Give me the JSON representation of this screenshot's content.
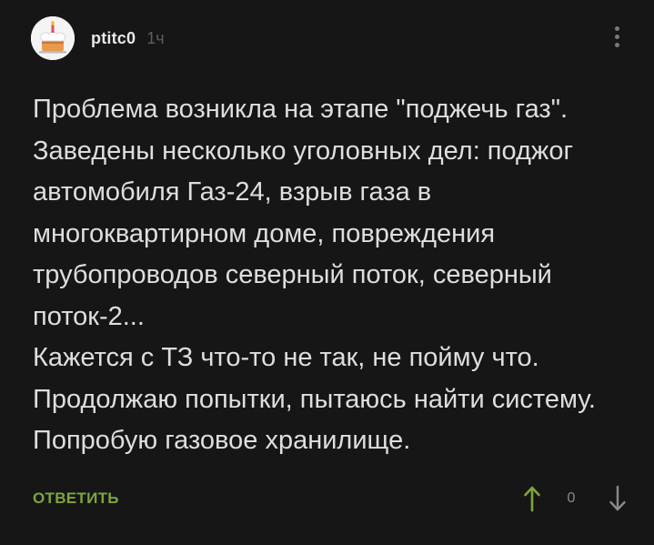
{
  "comment": {
    "author": "ptitc0",
    "time": "1ч",
    "paragraphs": [
      "Проблема возникла на этапе \"поджечь газ\". Заведены несколько уголовных дел: поджог автомобиля Газ-24, взрыв газа в многоквартирном доме, повреждения трубопроводов северный поток, северный поток-2...",
      "Кажется с ТЗ что-то не так, не пойму что. Продолжаю попытки, пытаюсь найти систему. Попробую газовое хранилище."
    ],
    "reply_label": "ОТВЕТИТЬ",
    "rating": "0"
  },
  "icons": {
    "avatar": "cake-avatar-icon",
    "more": "more-vertical-icon",
    "upvote": "arrow-up-icon",
    "downvote": "arrow-down-icon"
  },
  "colors": {
    "background": "#161616",
    "text": "#dedede",
    "username": "#e8e8e8",
    "muted": "#5e5e5e",
    "accent_green": "#7fa53c"
  }
}
